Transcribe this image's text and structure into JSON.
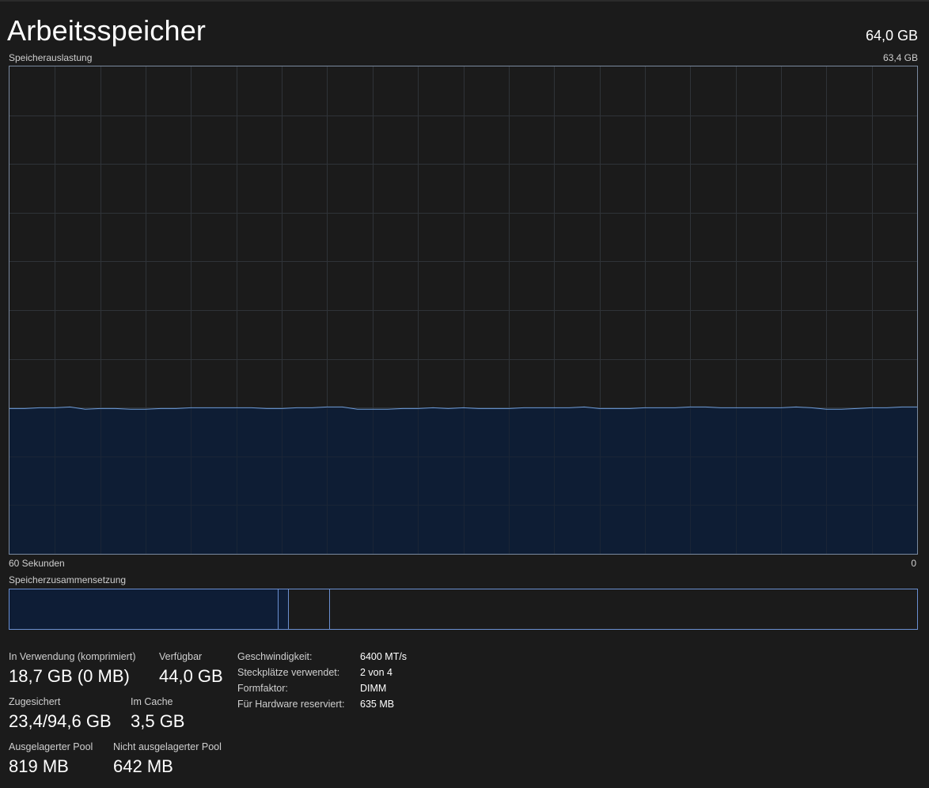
{
  "header": {
    "title": "Arbeitsspeicher",
    "total": "64,0 GB"
  },
  "graph": {
    "label": "Speicherauslastung",
    "max_label": "63,4 GB",
    "x_left_label": "60 Sekunden",
    "x_right_label": "0",
    "colors": {
      "fill": "#0e1d36",
      "line": "#6d9bd8",
      "grid": "#2f3338",
      "border": "#7a8aa0"
    }
  },
  "composition": {
    "label": "Speicherzusammensetzung",
    "segments": [
      {
        "name": "in-use",
        "fraction": 0.296
      },
      {
        "name": "modified",
        "fraction": 0.011
      },
      {
        "name": "standby",
        "fraction": 0.045
      },
      {
        "name": "free",
        "fraction": 0.648
      }
    ]
  },
  "chart_data": {
    "type": "area",
    "title": "Speicherauslastung",
    "xlabel": "",
    "ylabel": "",
    "x_range_labels": [
      "60 Sekunden",
      "0"
    ],
    "ylim": [
      0,
      63.4
    ],
    "y_unit": "GB",
    "grid": true,
    "series": [
      {
        "values": [
          18.9,
          18.9,
          19.0,
          19.0,
          19.1,
          18.8,
          18.9,
          18.9,
          18.8,
          18.8,
          18.9,
          18.9,
          19.0,
          19.0,
          19.0,
          19.0,
          19.0,
          18.9,
          18.9,
          19.0,
          19.0,
          19.1,
          19.1,
          18.8,
          18.8,
          18.8,
          18.9,
          18.9,
          19.0,
          18.9,
          19.0,
          18.9,
          18.9,
          18.9,
          19.0,
          19.0,
          19.0,
          19.0,
          19.1,
          18.9,
          18.9,
          18.9,
          19.0,
          19.0,
          19.0,
          19.1,
          19.1,
          19.0,
          19.0,
          19.0,
          19.0,
          19.0,
          19.1,
          19.0,
          18.8,
          18.8,
          18.9,
          19.0,
          19.0,
          19.1,
          19.1
        ]
      }
    ]
  },
  "stats": {
    "in_use_label": "In Verwendung (komprimiert)",
    "in_use_value": "18,7 GB (0 MB)",
    "available_label": "Verfügbar",
    "available_value": "44,0 GB",
    "committed_label": "Zugesichert",
    "committed_value": "23,4/94,6 GB",
    "cached_label": "Im Cache",
    "cached_value": "3,5 GB",
    "paged_label": "Ausgelagerter Pool",
    "paged_value": "819 MB",
    "nonpaged_label": "Nicht ausgelagerter Pool",
    "nonpaged_value": "642 MB"
  },
  "info": {
    "speed_label": "Geschwindigkeit:",
    "speed_value": "6400 MT/s",
    "slots_label": "Steckplätze verwendet:",
    "slots_value": "2 von 4",
    "form_label": "Formfaktor:",
    "form_value": "DIMM",
    "reserved_label": "Für Hardware reserviert:",
    "reserved_value": "635 MB"
  }
}
